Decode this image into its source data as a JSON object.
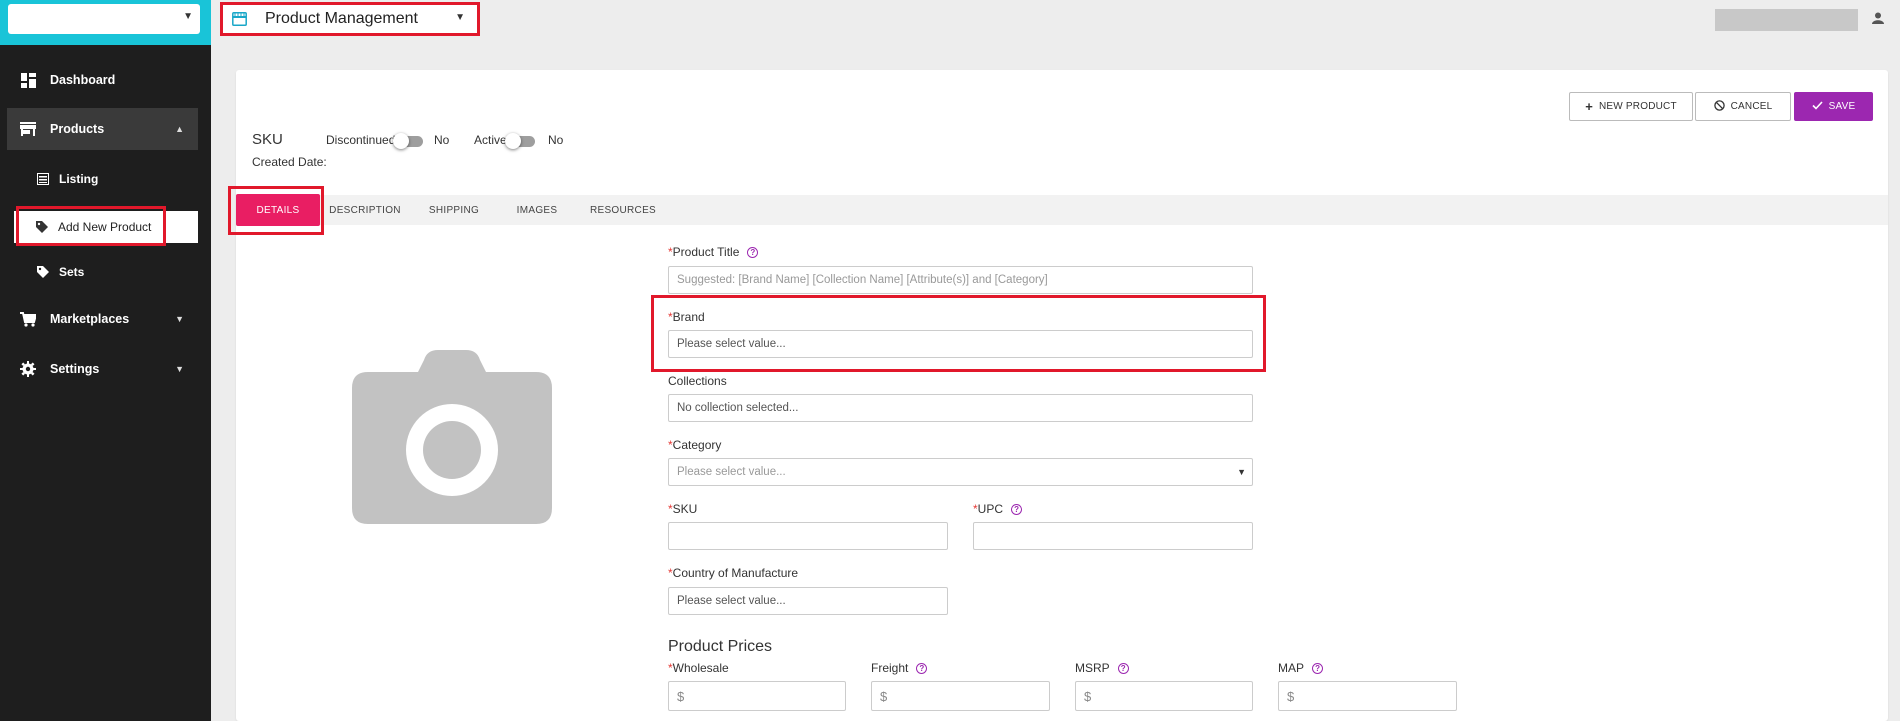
{
  "sidebar": {
    "top_select_value": "",
    "items": [
      {
        "label": "Dashboard",
        "icon": "dashboard-icon"
      },
      {
        "label": "Products",
        "icon": "store-icon"
      },
      {
        "label": "Marketplaces",
        "icon": "cart-icon"
      },
      {
        "label": "Settings",
        "icon": "gear-icon"
      }
    ],
    "products_sub": [
      {
        "label": "Listing",
        "icon": "list-icon"
      },
      {
        "label": "Add New Product",
        "icon": "tag-icon"
      },
      {
        "label": "Sets",
        "icon": "tag-icon"
      }
    ]
  },
  "header": {
    "module_label": "Product Management",
    "user_name": ""
  },
  "toolbar": {
    "new_product": "NEW PRODUCT",
    "cancel": "CANCEL",
    "save": "SAVE"
  },
  "status": {
    "sku_label": "SKU",
    "discontinued_label": "Discontinued",
    "discontinued_value": "No",
    "active_label": "Active",
    "active_value": "No",
    "created_date_label": "Created Date:"
  },
  "tabs": [
    "DETAILS",
    "DESCRIPTION",
    "SHIPPING",
    "IMAGES",
    "RESOURCES"
  ],
  "form": {
    "product_title": {
      "label": "Product Title",
      "placeholder": "Suggested: [Brand Name] [Collection Name] [Attribute(s)] and [Category]"
    },
    "brand": {
      "label": "Brand",
      "value": "Please select value..."
    },
    "collections": {
      "label": "Collections",
      "value": "No collection selected..."
    },
    "category": {
      "label": "Category",
      "placeholder": "Please select value..."
    },
    "sku": {
      "label": "SKU",
      "value": ""
    },
    "upc": {
      "label": "UPC",
      "value": ""
    },
    "country": {
      "label": "Country of Manufacture",
      "value": "Please select value..."
    }
  },
  "prices": {
    "title": "Product Prices",
    "currency_symbol": "$",
    "fields": [
      {
        "label": "Wholesale",
        "required": true
      },
      {
        "label": "Freight",
        "required": false
      },
      {
        "label": "MSRP",
        "required": false
      },
      {
        "label": "MAP",
        "required": false
      }
    ]
  },
  "colors": {
    "accent_purple": "#9c27b0",
    "accent_pink": "#e91e63",
    "sidebar_bg": "#1e1e1e",
    "sidebar_top": "#19c4d8",
    "highlight_red": "#e1182b"
  }
}
